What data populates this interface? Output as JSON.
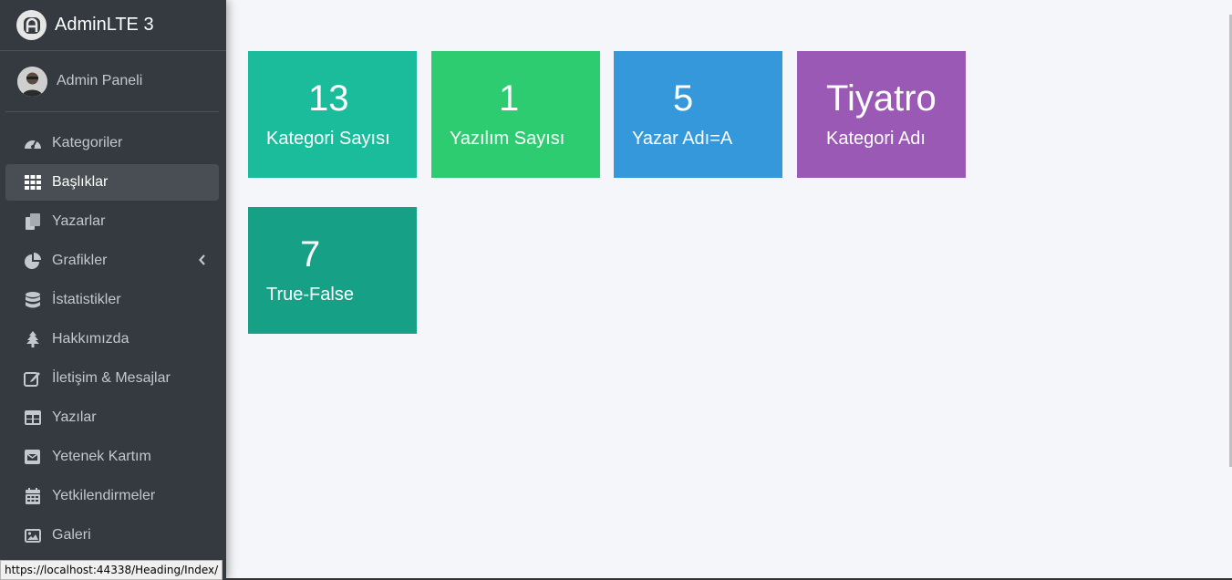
{
  "brand": {
    "title": "AdminLTE 3"
  },
  "user": {
    "name": "Admin Paneli"
  },
  "sidebar": {
    "items": [
      {
        "label": "Kategoriler",
        "icon": "tachometer-icon"
      },
      {
        "label": "Başlıklar",
        "icon": "th-grid-icon",
        "active": true
      },
      {
        "label": "Yazarlar",
        "icon": "copy-icon"
      },
      {
        "label": "Grafikler",
        "icon": "pie-chart-icon",
        "has_arrow": true
      },
      {
        "label": "İstatistikler",
        "icon": "database-icon"
      },
      {
        "label": "Hakkımızda",
        "icon": "tree-icon"
      },
      {
        "label": "İletişim & Mesajlar",
        "icon": "edit-icon"
      },
      {
        "label": "Yazılar",
        "icon": "table-icon"
      },
      {
        "label": "Yetenek Kartım",
        "icon": "envelope-icon"
      },
      {
        "label": "Yetkilendirmeler",
        "icon": "calendar-icon"
      },
      {
        "label": "Galeri",
        "icon": "image-icon"
      }
    ]
  },
  "boxes": [
    {
      "value": "13",
      "label": "Kategori Sayısı",
      "color": "#1abc9c"
    },
    {
      "value": "1",
      "label": "Yazılım Sayısı",
      "color": "#2ecc71"
    },
    {
      "value": "5",
      "label": "Yazar Adı=A",
      "color": "#3498db"
    },
    {
      "value": "Tiyatro",
      "label": "Kategori Adı",
      "color": "#9b59b6"
    },
    {
      "value": "7",
      "label": "True-False",
      "color": "#16a085"
    }
  ],
  "status": {
    "url": "https://localhost:44338/Heading/Index/"
  }
}
